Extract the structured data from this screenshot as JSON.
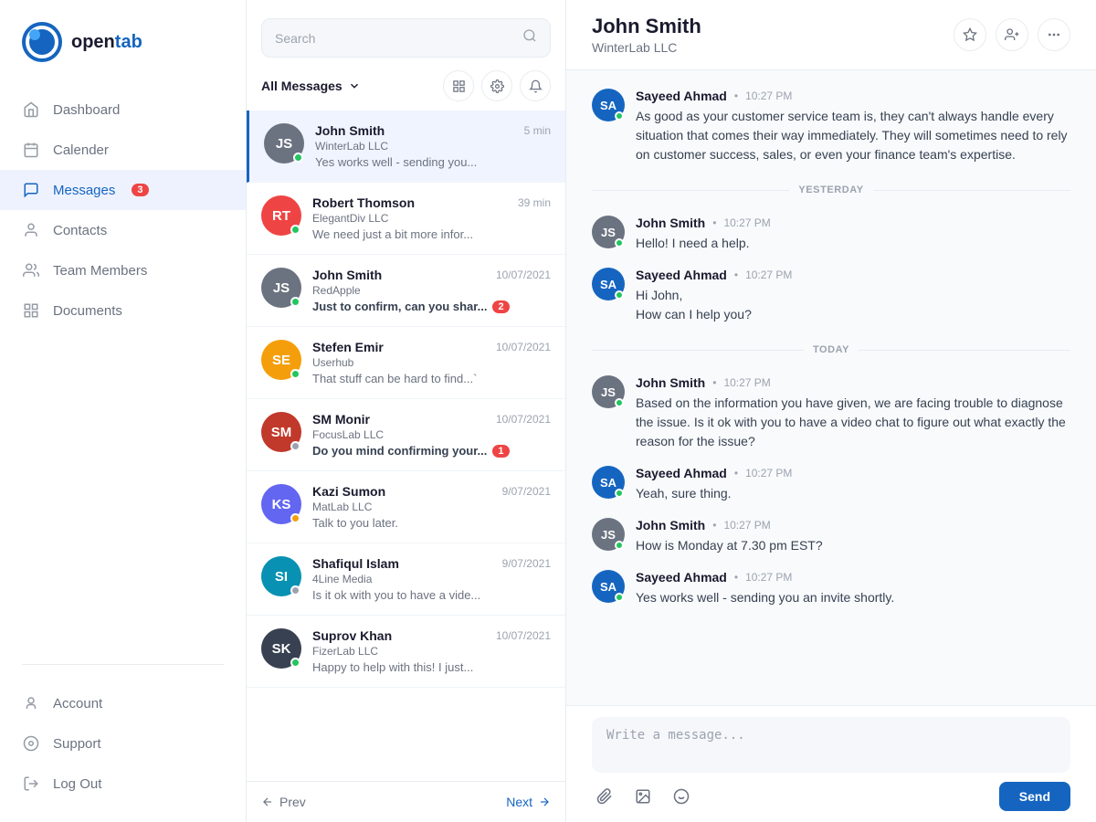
{
  "app": {
    "name": "open",
    "name_accent": "tab"
  },
  "sidebar": {
    "nav_items": [
      {
        "id": "dashboard",
        "label": "Dashboard",
        "icon": "home",
        "active": false
      },
      {
        "id": "calender",
        "label": "Calender",
        "icon": "calendar",
        "active": false
      },
      {
        "id": "messages",
        "label": "Messages",
        "icon": "messages",
        "active": true,
        "badge": "3"
      },
      {
        "id": "contacts",
        "label": "Contacts",
        "icon": "contacts",
        "active": false
      },
      {
        "id": "team-members",
        "label": "Team Members",
        "icon": "team",
        "active": false
      },
      {
        "id": "documents",
        "label": "Documents",
        "icon": "documents",
        "active": false
      }
    ],
    "bottom_items": [
      {
        "id": "account",
        "label": "Account",
        "icon": "account"
      },
      {
        "id": "support",
        "label": "Support",
        "icon": "support"
      },
      {
        "id": "logout",
        "label": "Log Out",
        "icon": "logout"
      }
    ]
  },
  "message_panel": {
    "search_placeholder": "Search",
    "filter_label": "All Messages",
    "messages": [
      {
        "id": 1,
        "name": "John Smith",
        "company": "WinterLab LLC",
        "time": "5 min",
        "preview": "Yes works well - sending you...",
        "active": true,
        "status": "online",
        "avatar_type": "photo",
        "avatar_color": "#6b7280",
        "initials": "JS",
        "unread": 0
      },
      {
        "id": 2,
        "name": "Robert Thomson",
        "company": "ElegantDiv LLC",
        "time": "39 min",
        "preview": "We need just a bit more infor...",
        "active": false,
        "status": "online",
        "avatar_type": "initials",
        "avatar_color": "#ef4444",
        "initials": "RT",
        "unread": 0
      },
      {
        "id": 3,
        "name": "John Smith",
        "company": "RedApple",
        "time": "10/07/2021",
        "preview": "Just to confirm, can you shar...",
        "active": false,
        "status": "online",
        "avatar_type": "photo",
        "avatar_color": "#6b7280",
        "initials": "JS",
        "unread": 2
      },
      {
        "id": 4,
        "name": "Stefen Emir",
        "company": "Userhub",
        "time": "10/07/2021",
        "preview": "That stuff can be hard to find...`",
        "active": false,
        "status": "online",
        "avatar_type": "photo",
        "avatar_color": "#f59e0b",
        "initials": "SE",
        "unread": 0
      },
      {
        "id": 5,
        "name": "SM Monir",
        "company": "FocusLab LLC",
        "time": "10/07/2021",
        "preview": "Do you mind confirming your...",
        "active": false,
        "status": "offline",
        "avatar_type": "photo",
        "avatar_color": "#c0392b",
        "initials": "SM",
        "unread": 1
      },
      {
        "id": 6,
        "name": "Kazi Sumon",
        "company": "MatLab LLC",
        "time": "9/07/2021",
        "preview": "Talk to you later.",
        "active": false,
        "status": "yellow",
        "avatar_type": "initials",
        "avatar_color": "#6366f1",
        "initials": "KS",
        "unread": 0
      },
      {
        "id": 7,
        "name": "Shafiqul Islam",
        "company": "4Line Media",
        "time": "9/07/2021",
        "preview": "Is it ok with you to have a vide...",
        "active": false,
        "status": "offline",
        "avatar_type": "initials",
        "avatar_color": "#0891b2",
        "initials": "SI",
        "unread": 0
      },
      {
        "id": 8,
        "name": "Suprov Khan",
        "company": "FizerLab LLC",
        "time": "10/07/2021",
        "preview": "Happy to help with this! I just...",
        "active": false,
        "status": "online",
        "avatar_type": "photo",
        "avatar_color": "#374151",
        "initials": "SK",
        "unread": 0
      }
    ],
    "prev_label": "Prev",
    "next_label": "Next"
  },
  "chat": {
    "contact_name": "John Smith",
    "contact_company": "WinterLab LLC",
    "input_placeholder": "Write a message...",
    "send_label": "Send",
    "sections": [
      {
        "label": "",
        "messages": [
          {
            "sender": "Sayeed Ahmad",
            "time": "10:27 PM",
            "avatar_color": "#1565c0",
            "initials": "SA",
            "text": "As good as your customer service team is, they can't always handle every situation that comes their way immediately. They will sometimes need to rely on customer success, sales, or even your finance team's expertise.",
            "status": "online"
          }
        ]
      },
      {
        "label": "YESTERDAY",
        "messages": [
          {
            "sender": "John Smith",
            "time": "10:27 PM",
            "avatar_color": "#6b7280",
            "initials": "JS",
            "text": "Hello! I need a help.",
            "status": "online"
          },
          {
            "sender": "Sayeed Ahmad",
            "time": "10:27 PM",
            "avatar_color": "#1565c0",
            "initials": "SA",
            "text": "Hi John,\nHow can I help you?",
            "status": "online"
          }
        ]
      },
      {
        "label": "TODAY",
        "messages": [
          {
            "sender": "John Smith",
            "time": "10:27 PM",
            "avatar_color": "#6b7280",
            "initials": "JS",
            "text": "Based on the information you have given, we are facing trouble to diagnose the issue. Is it ok with you to have a video chat to figure out what exactly the reason for the issue?",
            "status": "online"
          },
          {
            "sender": "Sayeed Ahmad",
            "time": "10:27 PM",
            "avatar_color": "#1565c0",
            "initials": "SA",
            "text": "Yeah, sure thing.",
            "status": "online"
          },
          {
            "sender": "John Smith",
            "time": "10:27 PM",
            "avatar_color": "#6b7280",
            "initials": "JS",
            "text": "How is Monday at 7.30 pm EST?",
            "status": "online"
          },
          {
            "sender": "Sayeed Ahmad",
            "time": "10:27 PM",
            "avatar_color": "#1565c0",
            "initials": "SA",
            "text": "Yes works well - sending you an invite shortly.",
            "status": "online"
          }
        ]
      }
    ]
  }
}
